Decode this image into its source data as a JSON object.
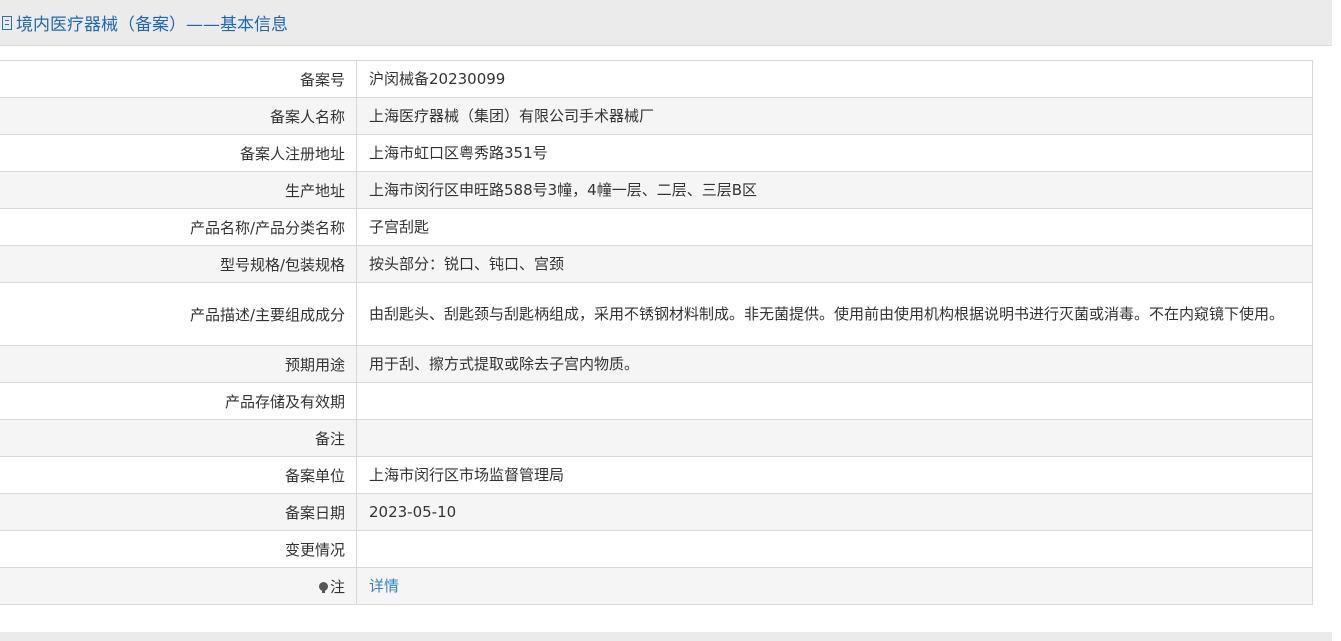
{
  "header": {
    "icon": "document-icon",
    "title": "境内医疗器械（备案）——基本信息"
  },
  "rows": [
    {
      "label": "备案号",
      "value": "沪闵械备20230099"
    },
    {
      "label": "备案人名称",
      "value": "上海医疗器械（集团）有限公司手术器械厂"
    },
    {
      "label": "备案人注册地址",
      "value": "上海市虹口区粤秀路351号"
    },
    {
      "label": "生产地址",
      "value": "上海市闵行区申旺路588号3幢，4幢一层、二层、三层B区"
    },
    {
      "label": "产品名称/产品分类名称",
      "value": "子宫刮匙"
    },
    {
      "label": "型号规格/包装规格",
      "value": "按头部分：锐口、钝口、宫颈"
    },
    {
      "label": "产品描述/主要组成成分",
      "value": "由刮匙头、刮匙颈与刮匙柄组成，采用不锈钢材料制成。非无菌提供。使用前由使用机构根据说明书进行灭菌或消毒。不在内窥镜下使用。"
    },
    {
      "label": "预期用途",
      "value": "用于刮、擦方式提取或除去子宫内物质。"
    },
    {
      "label": "产品存储及有效期",
      "value": ""
    },
    {
      "label": "备注",
      "value": ""
    },
    {
      "label": "备案单位",
      "value": "上海市闵行区市场监督管理局"
    },
    {
      "label": "备案日期",
      "value": "2023-05-10"
    },
    {
      "label": "变更情况",
      "value": ""
    }
  ],
  "note_row": {
    "icon": "lightbulb-icon",
    "label": "注",
    "link_text": "详情"
  }
}
